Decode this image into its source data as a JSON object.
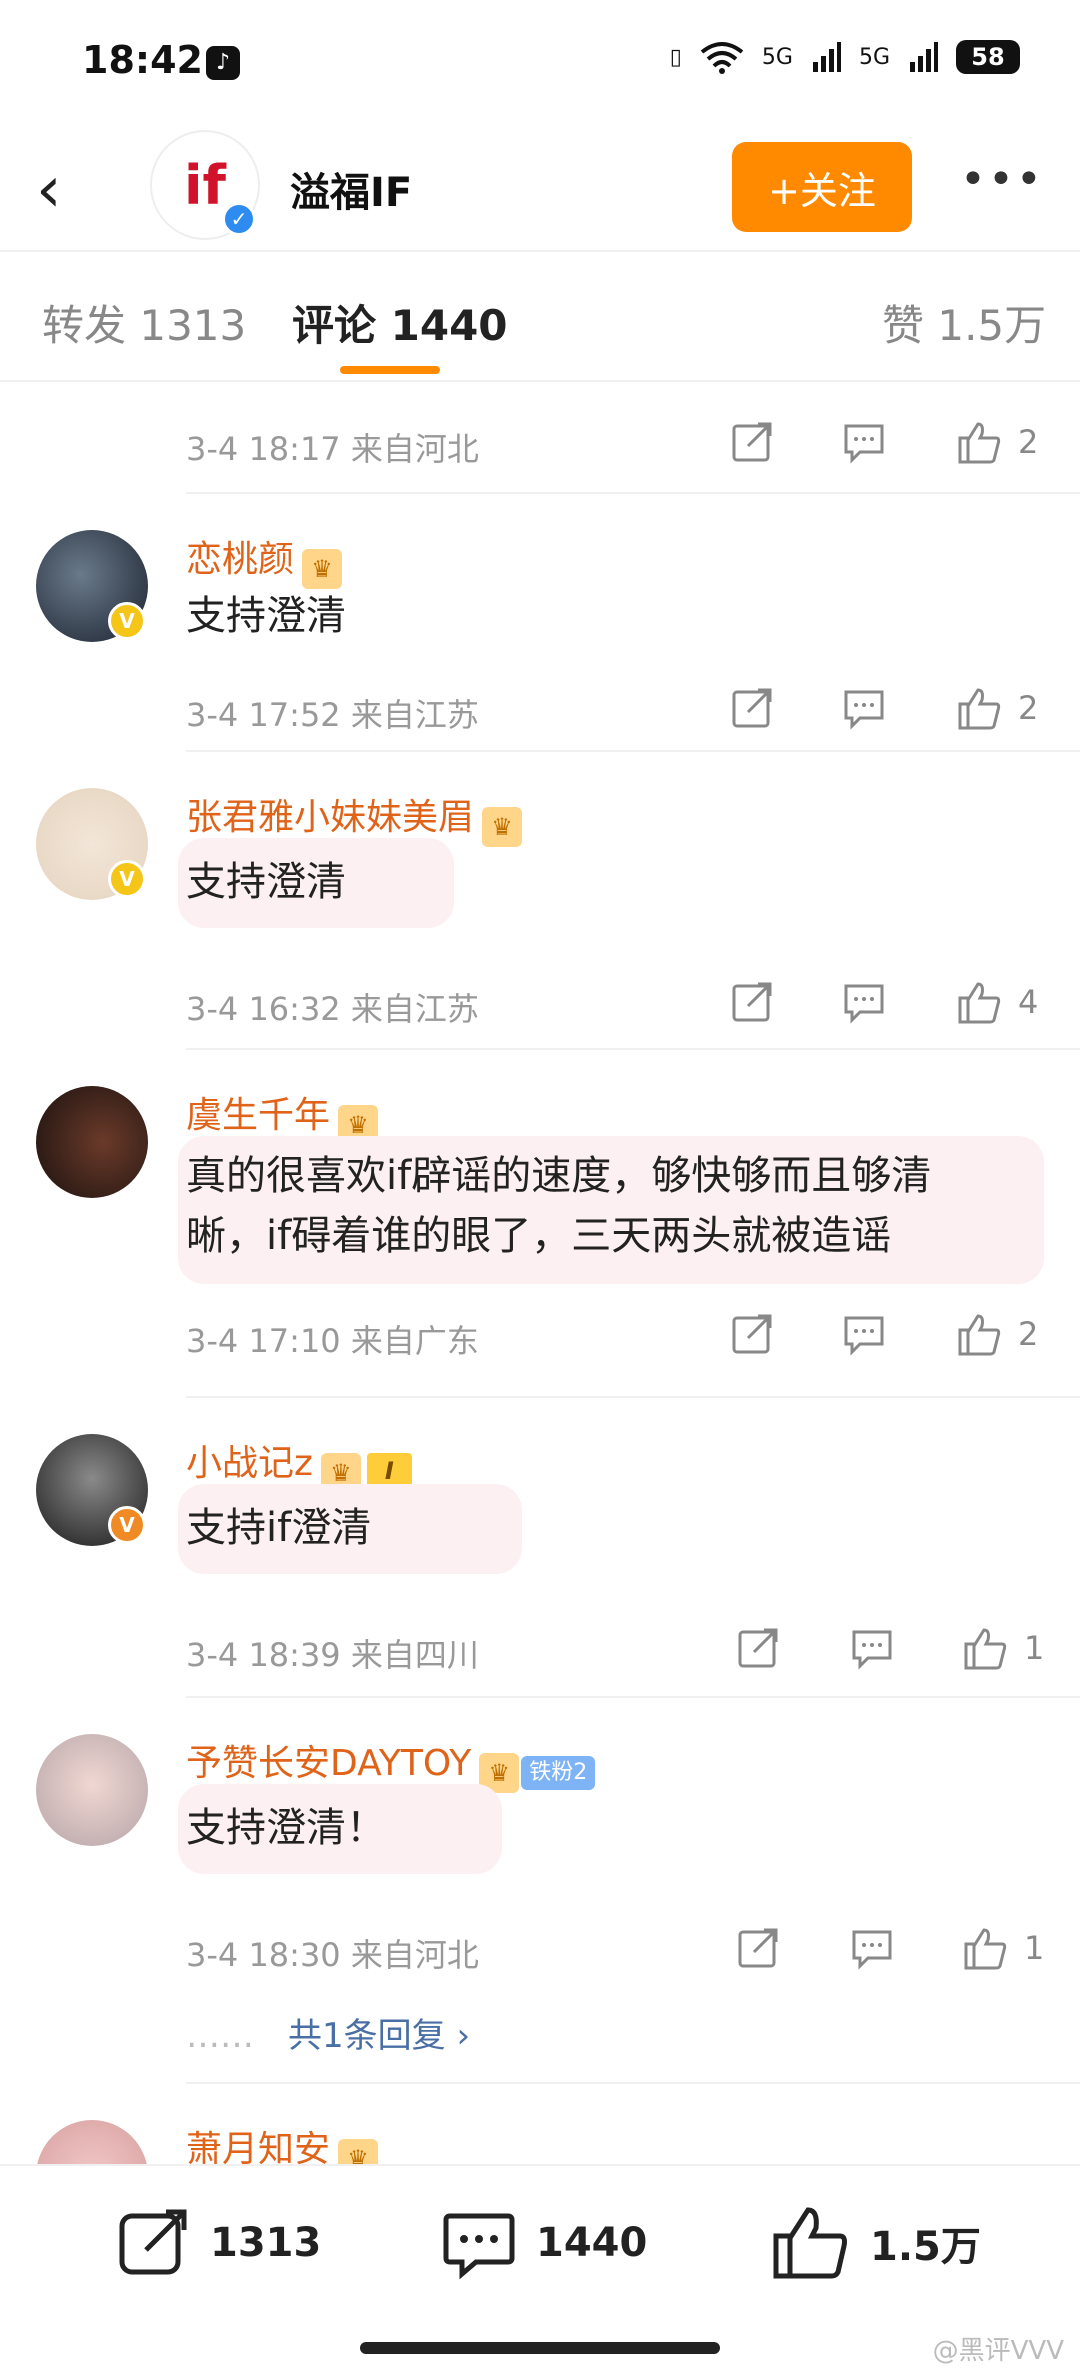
{
  "status": {
    "time": "18:42",
    "signal1": "5G",
    "signal2": "5G",
    "battery": "58"
  },
  "header": {
    "avatar_text": "if",
    "title": "溢福IF",
    "follow": "+关注",
    "more": "•••"
  },
  "tabs": {
    "repost": "转发 1313",
    "comment": "评论 1440",
    "like": "赞 1.5万"
  },
  "comments": [
    {
      "meta": "3-4 18:17  来自河北",
      "likes": "2"
    },
    {
      "user": "恋桃颜",
      "text": "支持澄清",
      "meta": "3-4 17:52  来自江苏",
      "likes": "2",
      "badge_color": "#f5c518"
    },
    {
      "user": "张君雅小妹妹美眉",
      "text": "支持澄清",
      "meta": "3-4 16:32  来自江苏",
      "likes": "4",
      "badge_color": "#f5c518"
    },
    {
      "user": "虞生千年",
      "text_line1": "真的很喜欢if辟谣的速度，够快够而且够清",
      "text_line2": "晰，if碍着谁的眼了，三天两头就被造谣",
      "meta": "3-4 17:10  来自广东",
      "likes": "2"
    },
    {
      "user": "小战记z",
      "level": "I",
      "text": "支持if澄清",
      "meta": "3-4 18:39  来自四川",
      "likes": "1",
      "badge_color": "#f08a24"
    },
    {
      "user": "予赞长安DAYTOY",
      "fan": "铁粉2",
      "text": "支持澄清！",
      "meta": "3-4 18:30  来自河北",
      "likes": "1",
      "replies": "共1条回复 ›",
      "replies_dots": "……"
    },
    {
      "user": "萧月知安"
    }
  ],
  "bottom": {
    "repost": "1313",
    "comment": "1440",
    "like": "1.5万"
  },
  "watermark": "@黑评VVV",
  "colors": {
    "accent": "#ff8a00",
    "username": "#e0631a",
    "bubble": "#fcf0f3"
  }
}
